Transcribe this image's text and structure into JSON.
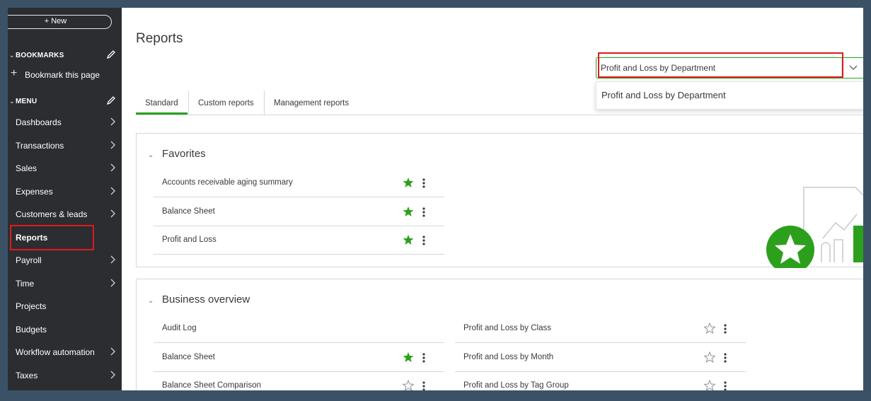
{
  "sidebar": {
    "new_label": "+ New",
    "bookmarks_heading": "BOOKMARKS",
    "bookmark_this_page": "Bookmark this page",
    "menu_heading": "MENU",
    "items": [
      {
        "label": "Dashboards",
        "chevron": true
      },
      {
        "label": "Transactions",
        "chevron": true
      },
      {
        "label": "Sales",
        "chevron": true
      },
      {
        "label": "Expenses",
        "chevron": true
      },
      {
        "label": "Customers & leads",
        "chevron": true
      },
      {
        "label": "Reports",
        "chevron": false
      },
      {
        "label": "Payroll",
        "chevron": true
      },
      {
        "label": "Time",
        "chevron": true
      },
      {
        "label": "Projects",
        "chevron": false
      },
      {
        "label": "Budgets",
        "chevron": false
      },
      {
        "label": "Workflow automation",
        "chevron": true
      },
      {
        "label": "Taxes",
        "chevron": true
      }
    ]
  },
  "main": {
    "title": "Reports",
    "search": {
      "value": "Profit and Loss by Department",
      "suggestion": "Profit and Loss by Department"
    },
    "tabs": [
      {
        "label": "Standard",
        "active": true
      },
      {
        "label": "Custom reports",
        "active": false
      },
      {
        "label": "Management reports",
        "active": false
      }
    ],
    "favorites": {
      "title": "Favorites",
      "rows": [
        {
          "name": "Accounts receivable aging summary",
          "starred": true
        },
        {
          "name": "Balance Sheet",
          "starred": true
        },
        {
          "name": "Profit and Loss",
          "starred": true
        }
      ]
    },
    "business_overview": {
      "title": "Business overview",
      "left_rows": [
        {
          "name": "Audit Log",
          "starred": false,
          "show_star": false
        },
        {
          "name": "Balance Sheet",
          "starred": true,
          "show_star": true
        },
        {
          "name": "Balance Sheet Comparison",
          "starred": false,
          "show_star": true
        }
      ],
      "right_rows": [
        {
          "name": "Profit and Loss by Class",
          "starred": false
        },
        {
          "name": "Profit and Loss by Month",
          "starred": false
        },
        {
          "name": "Profit and Loss by Tag Group",
          "starred": false
        }
      ]
    }
  },
  "colors": {
    "brand_green": "#2ca01c",
    "sidebar_bg": "#2b2d31",
    "highlight_red": "#e01b1b",
    "outer_bg": "#3b5266"
  }
}
